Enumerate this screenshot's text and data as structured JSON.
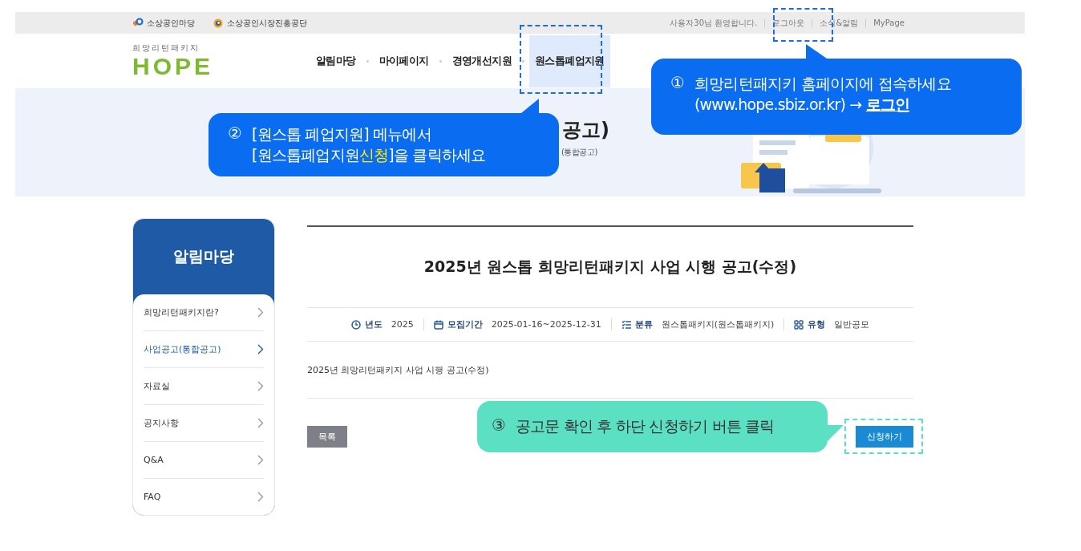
{
  "top_bar": {
    "links": [
      {
        "kind": "plus",
        "label": "소상공인마당"
      },
      {
        "kind": "ring",
        "label": "소상공인시장진흥공단"
      }
    ],
    "user_links": [
      "사용자30님 환영합니다.",
      "로그아웃",
      "소식&알림",
      "MyPage"
    ]
  },
  "header": {
    "logo_caption": "희망리턴패키지",
    "logo_text": "HOPE",
    "nav": [
      {
        "label": "알림마당",
        "selected": false
      },
      {
        "label": "마이페이지",
        "selected": false
      },
      {
        "label": "경영개선지원",
        "selected": false
      },
      {
        "label": "원스톱폐업지원",
        "selected": true
      }
    ]
  },
  "banner": {
    "title": "공고)",
    "subtitle": "(통합공고)"
  },
  "sidebar": {
    "title": "알림마당",
    "items": [
      {
        "label": "희망리턴패키지란?",
        "selected": false
      },
      {
        "label": "사업공고(통합공고)",
        "selected": true
      },
      {
        "label": "자료실",
        "selected": false
      },
      {
        "label": "공지사항",
        "selected": false
      },
      {
        "label": "Q&A",
        "selected": false
      },
      {
        "label": "FAQ",
        "selected": false
      }
    ]
  },
  "post": {
    "title": "2025년 원스톱 희망리턴패키지 사업 시행 공고(수정)",
    "meta": [
      {
        "kind": "clock",
        "label": "년도",
        "value": "2025"
      },
      {
        "kind": "calendar",
        "label": "모집기간",
        "value": "2025-01-16~2025-12-31"
      },
      {
        "kind": "list",
        "label": "분류",
        "value": "원스톱패키지(원스톱패키지)"
      },
      {
        "kind": "grid",
        "label": "유형",
        "value": "일반공모"
      }
    ],
    "body": "2025년 희망리턴패키지 사업 시행 공고(수정)",
    "list_button": "목록",
    "apply_button": "신청하기"
  },
  "callouts": [
    {
      "number": "①",
      "color": "#0a6cf0",
      "lines": [
        "희망리턴패지키 홈페이지에 접속하세요",
        "(www.hope.sbiz.or.kr) → **로그인**"
      ]
    },
    {
      "number": "②",
      "color": "#0a6cf0",
      "lines": [
        "[원스톱 폐업지원] 메뉴에서",
        "[원스톱폐업지원**신청**]을 클릭하세요"
      ]
    },
    {
      "number": "③",
      "color": "#5ce0c4",
      "lines": [
        "공고문 확인 후 하단 신청하기 버튼 클릭"
      ]
    }
  ]
}
